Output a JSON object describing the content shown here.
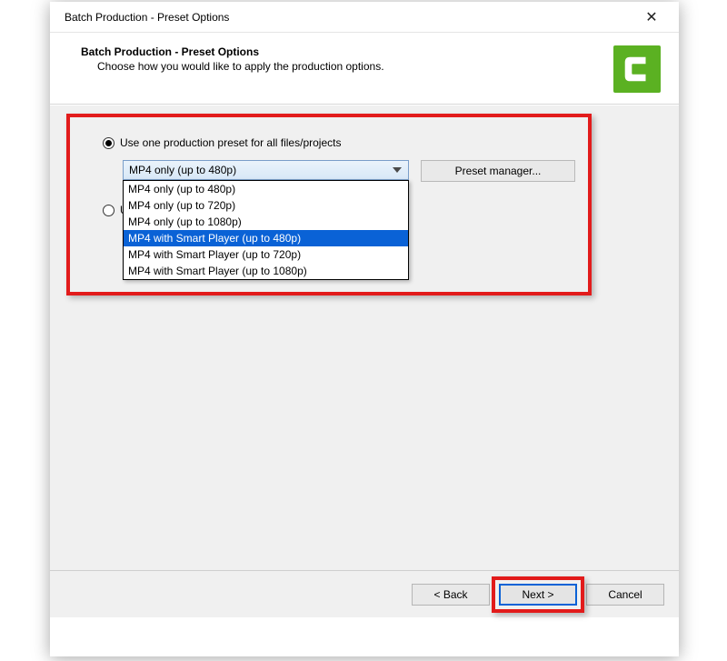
{
  "window": {
    "title": "Batch Production - Preset Options",
    "close_glyph": "✕"
  },
  "header": {
    "title": "Batch Production - Preset Options",
    "subtitle": "Choose how you would like to apply the production options."
  },
  "options": {
    "use_one_preset_label": "Use one production preset for all files/projects",
    "use_different_label_fragment": "U",
    "selected_radio": "use_one"
  },
  "combo": {
    "selected": "MP4 only (up to 480p)",
    "items": [
      "MP4 only (up to 480p)",
      "MP4 only (up to 720p)",
      "MP4 only (up to 1080p)",
      "MP4 with Smart Player (up to 480p)",
      "MP4 with Smart Player (up to 720p)",
      "MP4 with Smart Player (up to 1080p)"
    ],
    "highlighted_index": 3
  },
  "preset_manager_label": "Preset manager...",
  "footer": {
    "back": "< Back",
    "next": "Next >",
    "cancel": "Cancel"
  }
}
